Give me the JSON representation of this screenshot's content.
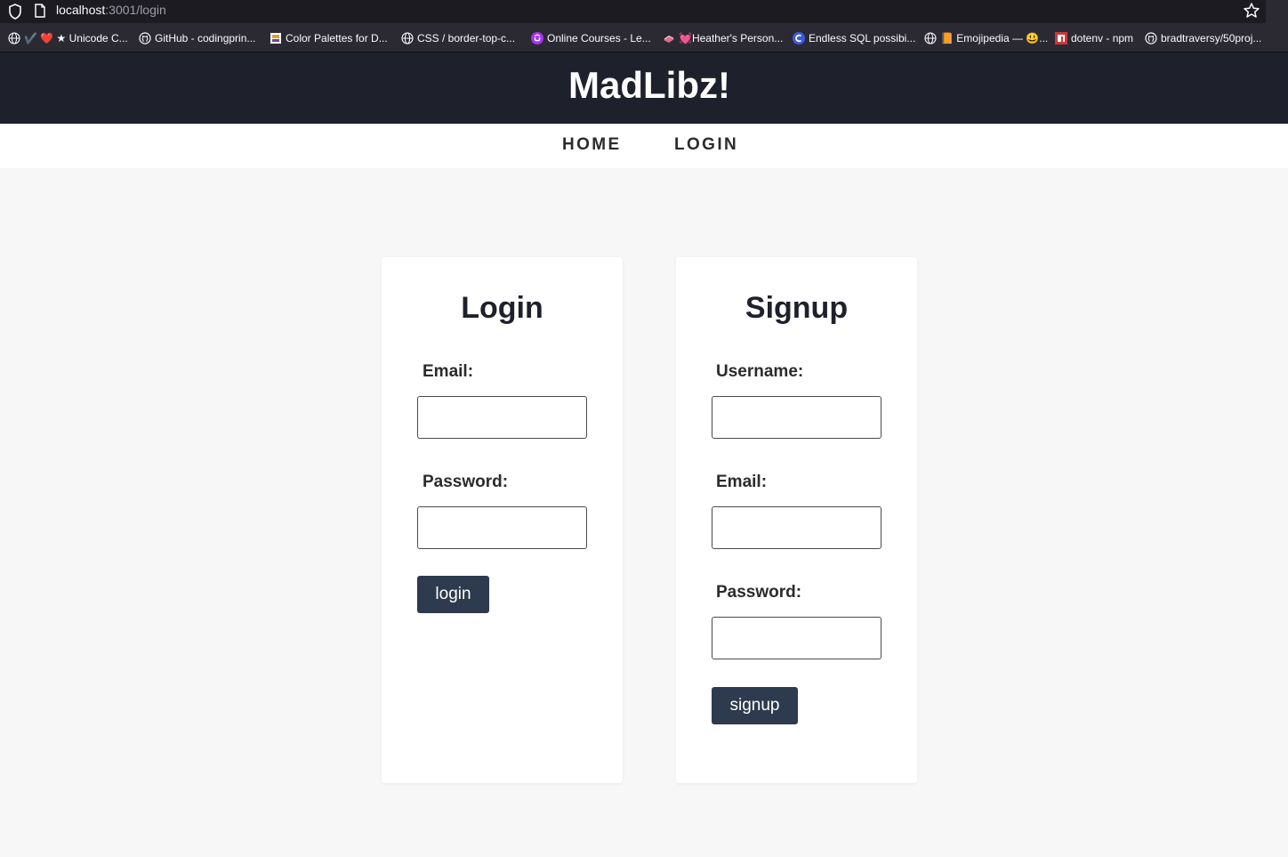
{
  "browser": {
    "url_host": "localhost",
    "url_rest": ":3001/login",
    "bookmarks": [
      {
        "icon": "globe-icon",
        "label": "✔️ ❤️ ★ Unicode C..."
      },
      {
        "icon": "github-icon",
        "label": "GitHub - codingprin..."
      },
      {
        "icon": "palette-favicon",
        "label": "Color Palettes for D..."
      },
      {
        "icon": "globe-icon",
        "label": "CSS / border-top-c..."
      },
      {
        "icon": "udemy-icon",
        "label": "Online Courses - Le..."
      },
      {
        "icon": "book-favicon",
        "label": "💓Heather's Person..."
      },
      {
        "icon": "c-favicon",
        "label": "Endless SQL possibi..."
      },
      {
        "icon": "globe-icon",
        "label": "📙 Emojipedia — 😃..."
      },
      {
        "icon": "npm-icon",
        "label": "dotenv - npm"
      },
      {
        "icon": "github-icon",
        "label": "bradtraversy/50proj..."
      }
    ]
  },
  "header": {
    "title": "MadLibz!"
  },
  "nav": {
    "home": "HOME",
    "login": "LOGIN"
  },
  "login_form": {
    "title": "Login",
    "email_label": "Email:",
    "email_value": "",
    "password_label": "Password:",
    "password_value": "",
    "submit_label": "login"
  },
  "signup_form": {
    "title": "Signup",
    "username_label": "Username:",
    "username_value": "",
    "email_label": "Email:",
    "email_value": "",
    "password_label": "Password:",
    "password_value": "",
    "submit_label": "signup"
  },
  "colors": {
    "header_bg": "#1e212b",
    "button_bg": "#2e3a4e",
    "page_bg": "#f7f7f7"
  }
}
